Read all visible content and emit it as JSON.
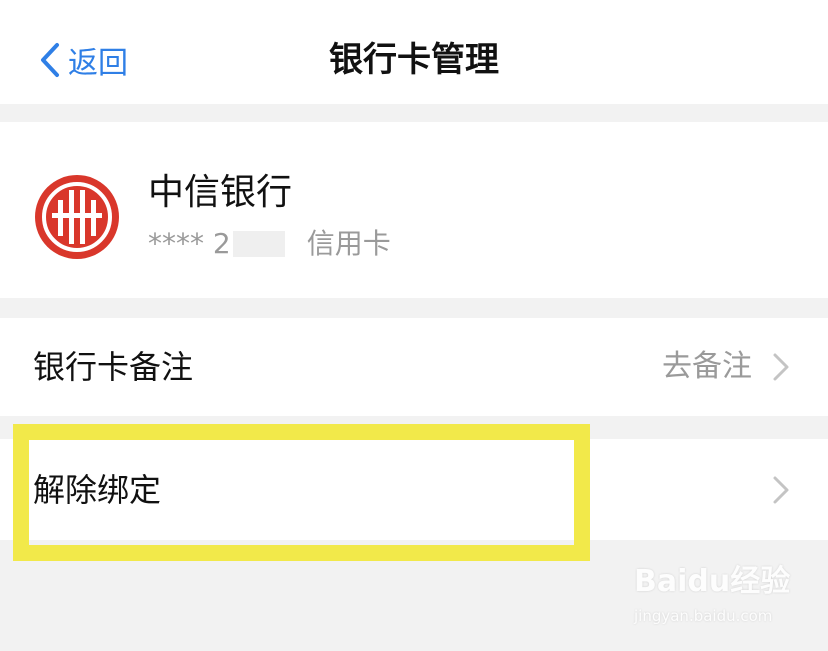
{
  "nav": {
    "back_label": "返回",
    "title": "银行卡管理"
  },
  "card": {
    "bank_name": "中信银行",
    "masked_number": "**** 2",
    "card_type": "信用卡"
  },
  "rows": {
    "remark_label": "银行卡备注",
    "remark_value": "去备注",
    "unbind_label": "解除绑定"
  },
  "watermark": {
    "brand": "Baidu经验",
    "url": "jingyan.baidu.com"
  },
  "colors": {
    "accent": "#2f7fe6",
    "bank_logo_red": "#d9372b",
    "highlight_yellow": "#f2e94a",
    "background": "#f2f2f2"
  }
}
